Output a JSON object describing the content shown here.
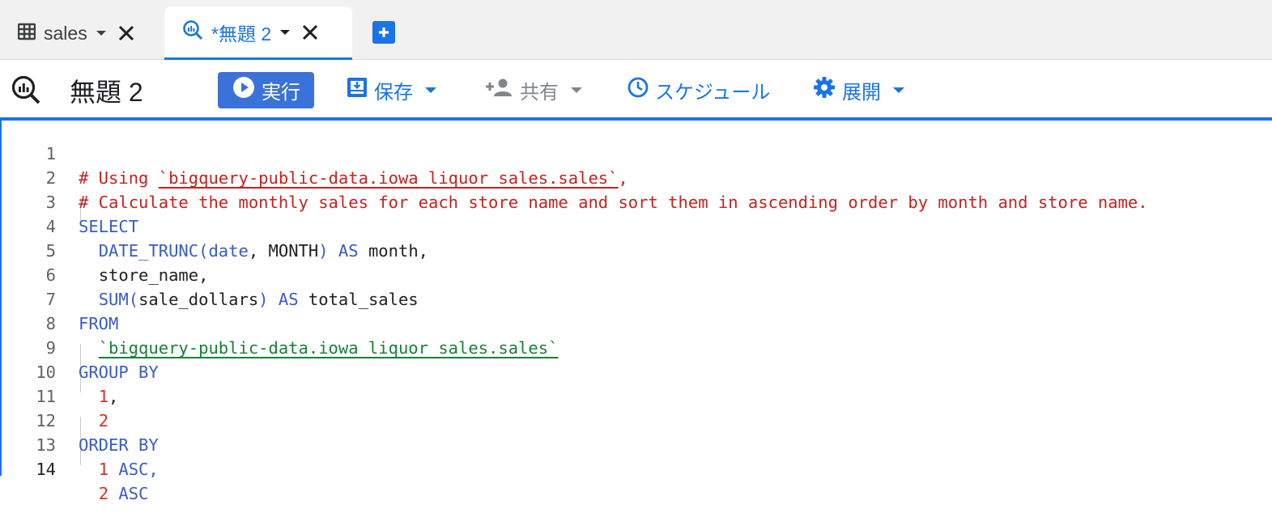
{
  "tabs": {
    "sales_label": "sales",
    "query_label": "*無題 2"
  },
  "toolbar": {
    "title": "無題 2",
    "run_label": "実行",
    "save_label": "保存",
    "share_label": "共有",
    "schedule_label": "スケジュール",
    "deploy_label": "展開"
  },
  "editor": {
    "line_numbers": [
      "1",
      "2",
      "3",
      "4",
      "5",
      "6",
      "7",
      "8",
      "9",
      "10",
      "11",
      "12",
      "13",
      "14"
    ],
    "line1_comment": "# Using ",
    "line1_table": "`bigquery-public-data.iowa_liquor_sales.sales`",
    "line1_comma": ",",
    "line2_comment": "# Calculate the monthly sales for each store name and sort them in ascending order by month and store name.",
    "line3_select": "SELECT",
    "line4_fn": "DATE_TRUNC(date",
    "line4_comma": ", ",
    "line4_arg": "MONTH",
    "line4_paren": ")",
    "line4_as": " AS ",
    "line4_alias": "month,",
    "line5_col": "store_name,",
    "line6_fn": "SUM(",
    "line6_arg": "sale_dollars",
    "line6_paren": ")",
    "line6_as": " AS ",
    "line6_alias": "total_sales",
    "line7_from": "FROM",
    "line8_table": "`bigquery-public-data.iowa_liquor_sales.sales`",
    "line9_group": "GROUP BY",
    "line10_num": "1",
    "line10_comma": ",",
    "line11_num": "2",
    "line12_order": "ORDER BY",
    "line13_num": "1",
    "line13_asc": " ASC,",
    "line14_num": "2",
    "line14_asc": " ASC"
  },
  "colors": {
    "accent": "#1a73e8",
    "run_button": "#3a72d9",
    "comment": "#c5221f",
    "keyword": "#3a5bc7",
    "number": "#d93025",
    "table_ref": "#188038"
  },
  "icons": [
    "table-icon",
    "query-icon",
    "caret-down-icon",
    "close-icon",
    "add-tab-icon",
    "play-icon",
    "save-icon",
    "add-person-icon",
    "clock-icon",
    "gear-icon"
  ]
}
